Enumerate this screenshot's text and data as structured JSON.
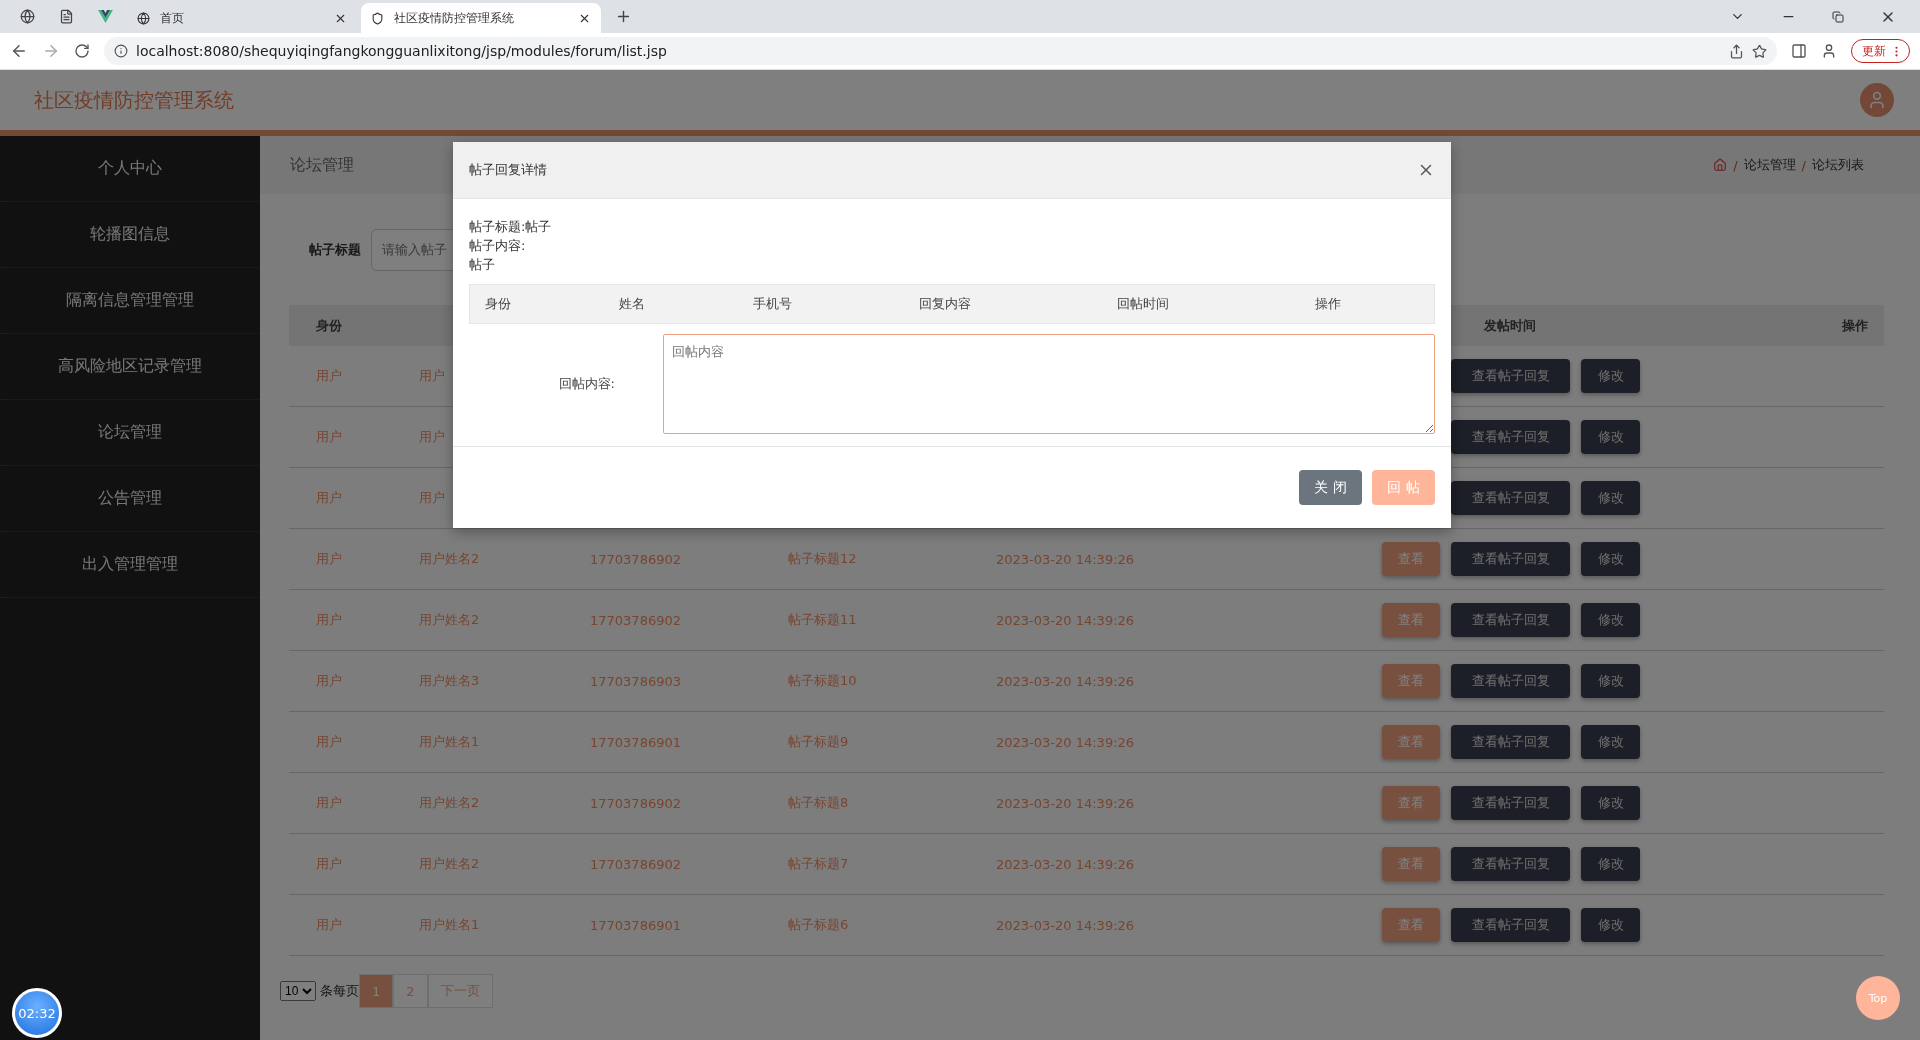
{
  "browser": {
    "tabs": [
      {
        "title": "首页",
        "selected": false
      },
      {
        "title": "社区疫情防控管理系统",
        "selected": true
      }
    ],
    "url": "localhost:8080/shequyiqingfangkongguanlixitong/jsp/modules/forum/list.jsp",
    "update_button": "更新"
  },
  "header": {
    "title": "社区疫情防控管理系统"
  },
  "sidebar": {
    "items": [
      {
        "label": "个人中心"
      },
      {
        "label": "轮播图信息"
      },
      {
        "label": "隔离信息管理管理"
      },
      {
        "label": "高风险地区记录管理"
      },
      {
        "label": "论坛管理"
      },
      {
        "label": "公告管理"
      },
      {
        "label": "出入管理管理"
      }
    ]
  },
  "page": {
    "section_title": "论坛管理",
    "breadcrumb": [
      {
        "separator": "/",
        "label": "论坛管理"
      },
      {
        "separator": "/",
        "label": "论坛列表"
      }
    ],
    "search": {
      "label": "帖子标题",
      "placeholder": "请输入帖子"
    },
    "table": {
      "columns": [
        {
          "label": "身份"
        },
        {
          "label": "发帖时间"
        },
        {
          "label": "操作"
        }
      ],
      "rows": [
        {
          "identity": "用户",
          "name": "用户",
          "buttons": [
            {
              "kind": "replies",
              "label": "查看帖子回复"
            },
            {
              "kind": "edit",
              "label": "修改"
            }
          ]
        },
        {
          "identity": "用户",
          "name": "用户",
          "buttons": [
            {
              "kind": "replies",
              "label": "查看帖子回复"
            },
            {
              "kind": "edit",
              "label": "修改"
            }
          ]
        },
        {
          "identity": "用户",
          "name": "用户",
          "buttons": [
            {
              "kind": "replies",
              "label": "查看帖子回复"
            },
            {
              "kind": "edit",
              "label": "修改"
            }
          ]
        },
        {
          "identity": "用户",
          "name": "用户姓名2",
          "phone": "17703786902",
          "title": "帖子标题12",
          "time": "2023-03-20 14:39:26",
          "buttons": [
            {
              "kind": "view",
              "label": "查看"
            },
            {
              "kind": "replies",
              "label": "查看帖子回复"
            },
            {
              "kind": "edit",
              "label": "修改"
            }
          ]
        },
        {
          "identity": "用户",
          "name": "用户姓名2",
          "phone": "17703786902",
          "title": "帖子标题11",
          "time": "2023-03-20 14:39:26",
          "buttons": [
            {
              "kind": "view",
              "label": "查看"
            },
            {
              "kind": "replies",
              "label": "查看帖子回复"
            },
            {
              "kind": "edit",
              "label": "修改"
            }
          ]
        },
        {
          "identity": "用户",
          "name": "用户姓名3",
          "phone": "17703786903",
          "title": "帖子标题10",
          "time": "2023-03-20 14:39:26",
          "buttons": [
            {
              "kind": "view",
              "label": "查看"
            },
            {
              "kind": "replies",
              "label": "查看帖子回复"
            },
            {
              "kind": "edit",
              "label": "修改"
            }
          ]
        },
        {
          "identity": "用户",
          "name": "用户姓名1",
          "phone": "17703786901",
          "title": "帖子标题9",
          "time": "2023-03-20 14:39:26",
          "buttons": [
            {
              "kind": "view",
              "label": "查看"
            },
            {
              "kind": "replies",
              "label": "查看帖子回复"
            },
            {
              "kind": "edit",
              "label": "修改"
            }
          ]
        },
        {
          "identity": "用户",
          "name": "用户姓名2",
          "phone": "17703786902",
          "title": "帖子标题8",
          "time": "2023-03-20 14:39:26",
          "buttons": [
            {
              "kind": "view",
              "label": "查看"
            },
            {
              "kind": "replies",
              "label": "查看帖子回复"
            },
            {
              "kind": "edit",
              "label": "修改"
            }
          ]
        },
        {
          "identity": "用户",
          "name": "用户姓名2",
          "phone": "17703786902",
          "title": "帖子标题7",
          "time": "2023-03-20 14:39:26",
          "buttons": [
            {
              "kind": "view",
              "label": "查看"
            },
            {
              "kind": "replies",
              "label": "查看帖子回复"
            },
            {
              "kind": "edit",
              "label": "修改"
            }
          ]
        },
        {
          "identity": "用户",
          "name": "用户姓名1",
          "phone": "17703786901",
          "title": "帖子标题6",
          "time": "2023-03-20 14:39:26",
          "buttons": [
            {
              "kind": "view",
              "label": "查看"
            },
            {
              "kind": "replies",
              "label": "查看帖子回复"
            },
            {
              "kind": "edit",
              "label": "修改"
            }
          ]
        }
      ]
    },
    "pagination": {
      "page_size": "10",
      "page_size_label": "条每页",
      "pages": [
        {
          "label": "1",
          "selected": true
        },
        {
          "label": "2",
          "selected": false
        }
      ],
      "next": "下一页"
    }
  },
  "modal": {
    "title": "帖子回复详情",
    "info": [
      "帖子标题:帖子",
      "帖子内容:",
      "帖子"
    ],
    "columns": [
      "身份",
      "姓名",
      "手机号",
      "回复内容",
      "回帖时间",
      "操作"
    ],
    "form": {
      "label": "回帖内容:",
      "placeholder": "回帖内容"
    },
    "buttons": [
      {
        "kind": "close",
        "label": "关 闭"
      },
      {
        "kind": "submit",
        "label": "回 帖"
      }
    ]
  },
  "timer": "02:32",
  "top_button": "Top"
}
